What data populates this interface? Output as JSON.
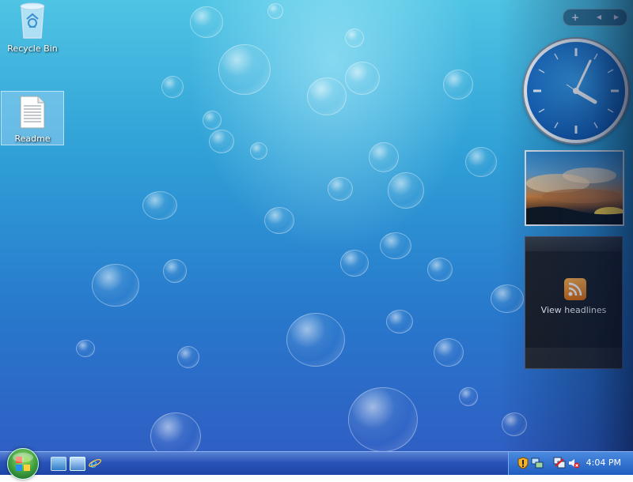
{
  "desktop": {
    "icons": [
      {
        "label": "Recycle Bin",
        "icon": "recycle-bin-icon"
      },
      {
        "label": "Readme",
        "icon": "document-icon"
      }
    ]
  },
  "sidebar": {
    "controls": {
      "add": "+",
      "prev": "◀",
      "next": "▶"
    },
    "clock": {
      "icon": "analog-clock"
    },
    "slideshow": {
      "icon": "sunset-photo"
    },
    "feed": {
      "label": "View headlines",
      "icon": "rss-icon"
    }
  },
  "taskbar": {
    "start_icon": "windows-orb",
    "quick_launch": [
      "show-desktop-icon",
      "switch-windows-icon",
      "internet-explorer-icon"
    ],
    "tray_icons": [
      "security-shield-icon",
      "network-status-icon",
      "network-icon",
      "volume-muted-icon"
    ],
    "time": "4:04 PM"
  }
}
